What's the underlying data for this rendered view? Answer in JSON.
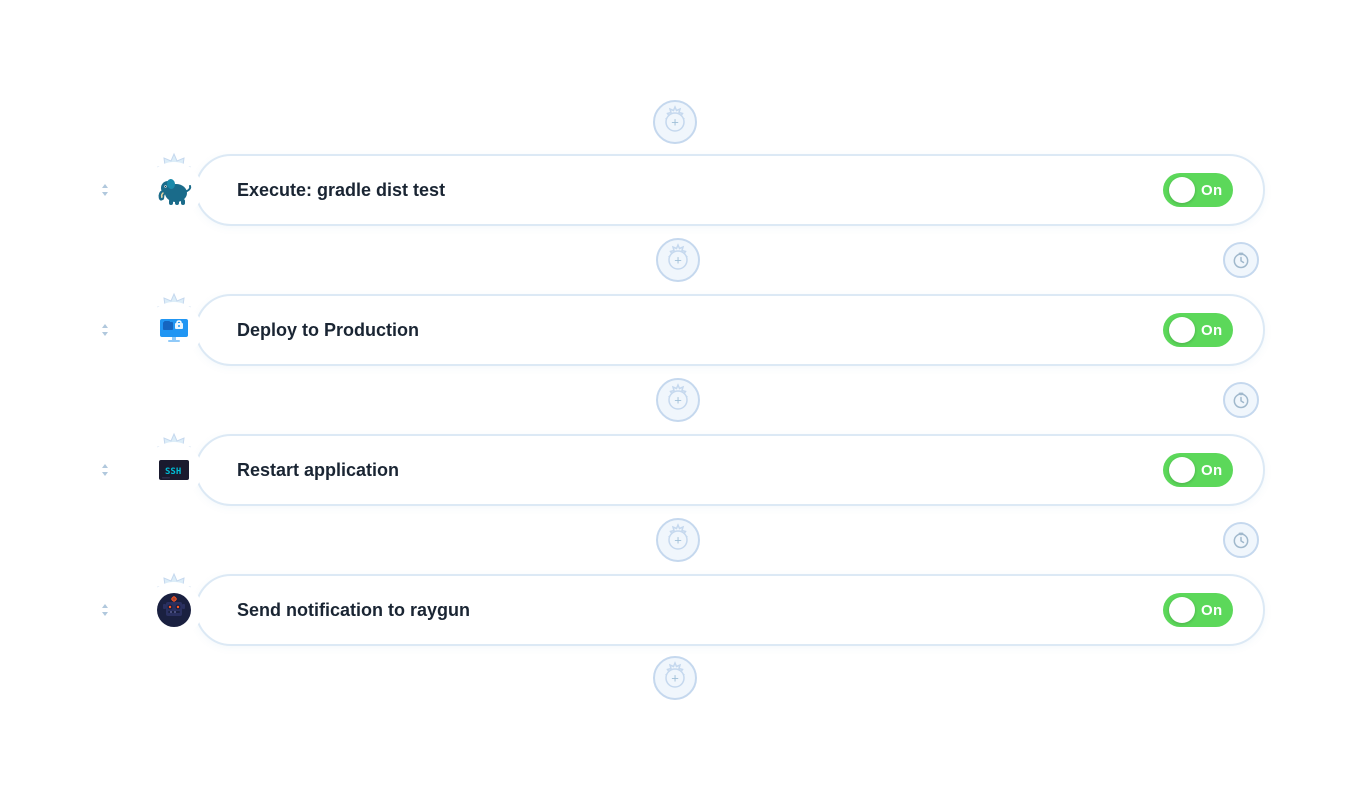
{
  "pipeline": {
    "steps": [
      {
        "id": "step-1",
        "label": "Execute: gradle dist test",
        "toggle": "On",
        "icon_type": "gradle",
        "icon_color": "#1a6b8a"
      },
      {
        "id": "step-2",
        "label": "Deploy to Production",
        "toggle": "On",
        "icon_type": "deploy",
        "icon_color": "#2196f3"
      },
      {
        "id": "step-3",
        "label": "Restart application",
        "toggle": "On",
        "icon_type": "ssh",
        "icon_color": "#1a1a2e"
      },
      {
        "id": "step-4",
        "label": "Send notification to raygun",
        "toggle": "On",
        "icon_type": "raygun",
        "icon_color": "#1a2040"
      }
    ],
    "toggle_on_label": "On",
    "toggle_bg_color": "#5cd85a"
  }
}
